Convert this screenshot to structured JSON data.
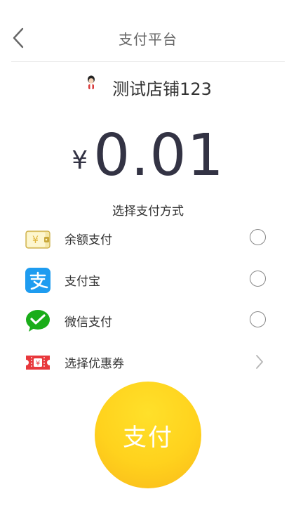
{
  "header": {
    "title": "支付平台",
    "back_icon": "chevron-left-icon"
  },
  "shop": {
    "avatar_icon": "shop-avatar-icon",
    "name": "测试店铺123"
  },
  "payment": {
    "currency_symbol": "¥",
    "amount": "0.01"
  },
  "method_heading": "选择支付方式",
  "methods": [
    {
      "label": "余额支付",
      "icon": "wallet-icon",
      "selected": false
    },
    {
      "label": "支付宝",
      "icon": "alipay-icon",
      "selected": false
    },
    {
      "label": "微信支付",
      "icon": "wechat-pay-icon",
      "selected": false
    }
  ],
  "coupon": {
    "label": "选择优惠券",
    "icon": "coupon-icon"
  },
  "pay_button": {
    "label": "支付"
  },
  "colors": {
    "alipay": "#1e9cf0",
    "wechat": "#1aad19",
    "coupon": "#e8383c",
    "pay_button": "#ffd21d"
  }
}
